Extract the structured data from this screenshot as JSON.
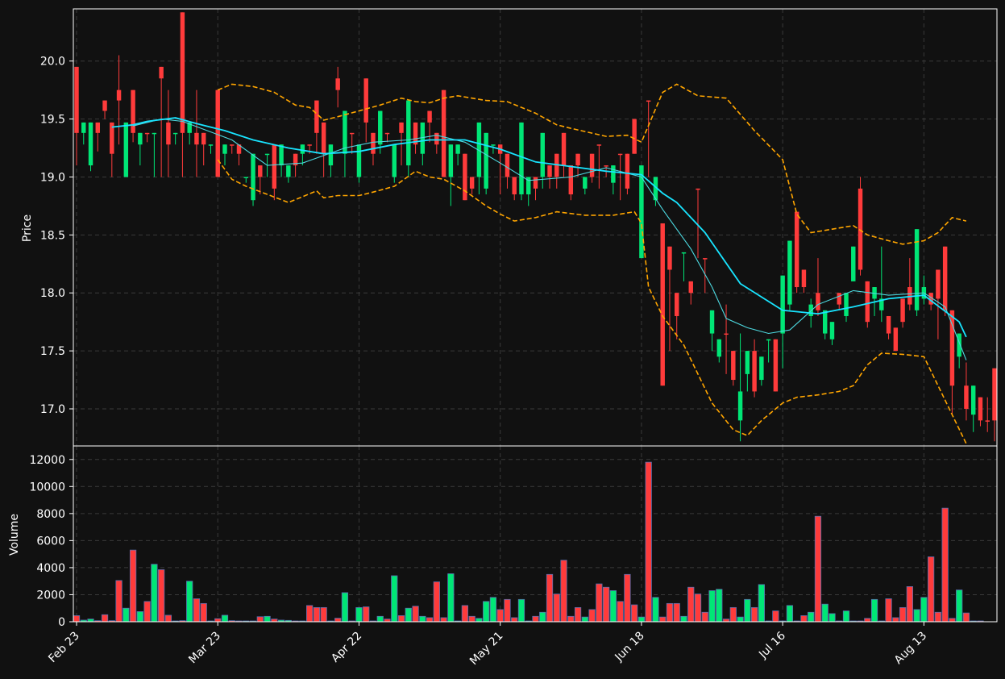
{
  "chart_data": {
    "type": "candlestick",
    "price_panel": {
      "ylabel": "Price",
      "ylim": [
        16.68,
        20.45
      ],
      "yticks": [
        17.0,
        17.5,
        18.0,
        18.5,
        19.0,
        19.5,
        20.0
      ],
      "ytick_labels": [
        "17.0",
        "17.5",
        "18.0",
        "18.5",
        "19.0",
        "19.5",
        "20.0"
      ],
      "grid": true
    },
    "volume_panel": {
      "ylabel": "Volume",
      "ylim": [
        0,
        13000
      ],
      "yticks": [
        0,
        2000,
        4000,
        6000,
        8000,
        10000,
        12000
      ],
      "ytick_labels": [
        "0",
        "2000",
        "4000",
        "6000",
        "8000",
        "10000",
        "12000"
      ],
      "grid": true
    },
    "x_axis": {
      "tick_labels": [
        "Feb 23",
        "Mar 23",
        "Apr 22",
        "May 21",
        "Jun 18",
        "Jul 16",
        "Aug 13"
      ],
      "tick_index": [
        0,
        20,
        40,
        60,
        80,
        100,
        120
      ]
    },
    "colors": {
      "up": "#00e676",
      "down": "#ff3b3b",
      "ma_short": "#4dd9e0",
      "ma_long": "#18e4ff",
      "bands": "#ffa500",
      "grid": "#3a3a3a",
      "frame": "#ffffff"
    },
    "candles": [
      [
        19.38,
        19.95,
        19.1,
        19.95
      ],
      [
        19.38,
        19.47,
        19.28,
        19.47
      ],
      [
        19.1,
        19.47,
        19.05,
        19.47
      ],
      [
        19.38,
        19.47,
        19.22,
        19.47
      ],
      [
        19.57,
        19.66,
        19.5,
        19.66
      ],
      [
        19.2,
        19.47,
        19.0,
        19.47
      ],
      [
        19.66,
        19.75,
        19.28,
        20.05
      ],
      [
        19.0,
        19.47,
        19.0,
        19.47
      ],
      [
        19.38,
        19.75,
        19.3,
        19.75
      ],
      [
        19.28,
        19.38,
        19.1,
        19.38
      ],
      [
        19.38,
        19.38,
        19.3,
        19.38
      ],
      [
        19.38,
        19.38,
        19.0,
        19.38
      ],
      [
        19.85,
        19.95,
        19.0,
        19.95
      ],
      [
        19.28,
        19.47,
        19.0,
        19.75
      ],
      [
        19.38,
        19.38,
        19.28,
        19.38
      ],
      [
        19.38,
        20.42,
        19.0,
        20.42
      ],
      [
        19.38,
        19.47,
        19.28,
        19.47
      ],
      [
        19.28,
        19.38,
        19.0,
        19.75
      ],
      [
        19.28,
        19.38,
        19.1,
        19.38
      ],
      [
        19.28,
        19.28,
        19.2,
        19.28
      ],
      [
        19.0,
        19.75,
        19.0,
        19.75
      ],
      [
        19.2,
        19.28,
        19.1,
        19.28
      ],
      [
        19.28,
        19.28,
        19.2,
        19.28
      ],
      [
        19.2,
        19.28,
        19.1,
        19.28
      ],
      [
        19.0,
        19.0,
        18.95,
        19.0
      ],
      [
        18.8,
        19.2,
        18.75,
        19.2
      ],
      [
        19.0,
        19.1,
        18.85,
        19.1
      ],
      [
        19.2,
        19.2,
        19.0,
        19.2
      ],
      [
        18.9,
        19.28,
        18.8,
        19.28
      ],
      [
        19.1,
        19.28,
        19.0,
        19.28
      ],
      [
        19.0,
        19.1,
        18.95,
        19.1
      ],
      [
        19.1,
        19.2,
        19.0,
        19.2
      ],
      [
        19.2,
        19.28,
        19.1,
        19.28
      ],
      [
        19.28,
        19.28,
        19.2,
        19.28
      ],
      [
        19.38,
        19.66,
        19.2,
        19.66
      ],
      [
        19.2,
        19.47,
        19.0,
        19.47
      ],
      [
        19.1,
        19.28,
        19.0,
        19.28
      ],
      [
        19.75,
        19.85,
        19.6,
        19.95
      ],
      [
        19.2,
        19.57,
        19.0,
        19.57
      ],
      [
        19.38,
        19.38,
        19.2,
        19.38
      ],
      [
        19.0,
        19.28,
        18.95,
        19.28
      ],
      [
        19.47,
        19.85,
        19.3,
        19.85
      ],
      [
        19.2,
        19.38,
        19.1,
        19.38
      ],
      [
        19.28,
        19.57,
        19.2,
        19.57
      ],
      [
        19.38,
        19.38,
        19.3,
        19.38
      ],
      [
        19.0,
        19.28,
        18.95,
        19.28
      ],
      [
        19.38,
        19.47,
        19.1,
        19.47
      ],
      [
        19.1,
        19.66,
        19.0,
        19.66
      ],
      [
        19.28,
        19.47,
        19.2,
        19.47
      ],
      [
        19.2,
        19.47,
        19.1,
        19.47
      ],
      [
        19.47,
        19.57,
        19.3,
        19.57
      ],
      [
        19.28,
        19.38,
        19.2,
        19.38
      ],
      [
        19.0,
        19.75,
        19.0,
        19.75
      ],
      [
        19.0,
        19.28,
        18.75,
        19.28
      ],
      [
        19.2,
        19.28,
        19.1,
        19.28
      ],
      [
        18.8,
        19.2,
        18.8,
        19.2
      ],
      [
        18.9,
        19.0,
        18.85,
        19.0
      ],
      [
        19.0,
        19.47,
        18.85,
        19.47
      ],
      [
        18.9,
        19.38,
        18.85,
        19.38
      ],
      [
        19.28,
        19.28,
        19.2,
        19.28
      ],
      [
        19.2,
        19.28,
        18.85,
        19.28
      ],
      [
        19.0,
        19.2,
        18.9,
        19.2
      ],
      [
        18.85,
        19.0,
        18.8,
        19.0
      ],
      [
        18.85,
        19.47,
        18.8,
        19.47
      ],
      [
        18.85,
        19.0,
        18.75,
        19.0
      ],
      [
        18.9,
        19.0,
        18.8,
        19.0
      ],
      [
        19.0,
        19.38,
        18.9,
        19.38
      ],
      [
        19.0,
        19.1,
        18.9,
        19.1
      ],
      [
        19.0,
        19.2,
        18.9,
        19.2
      ],
      [
        19.1,
        19.38,
        19.0,
        19.38
      ],
      [
        18.85,
        19.1,
        18.8,
        19.1
      ],
      [
        19.1,
        19.2,
        19.0,
        19.2
      ],
      [
        18.9,
        19.0,
        18.85,
        19.0
      ],
      [
        19.0,
        19.2,
        18.95,
        19.2
      ],
      [
        19.28,
        19.28,
        18.9,
        19.28
      ],
      [
        19.1,
        19.1,
        19.0,
        19.1
      ],
      [
        18.95,
        19.1,
        18.85,
        19.1
      ],
      [
        19.2,
        19.2,
        18.8,
        19.2
      ],
      [
        18.9,
        19.2,
        18.85,
        19.2
      ],
      [
        19.2,
        19.5,
        19.2,
        19.5
      ],
      [
        18.3,
        19.1,
        18.3,
        19.1
      ],
      [
        19.66,
        19.66,
        19.0,
        19.66
      ],
      [
        18.8,
        19.0,
        18.75,
        19.0
      ],
      [
        17.2,
        18.6,
        17.2,
        18.6
      ],
      [
        18.2,
        18.4,
        17.5,
        18.4
      ],
      [
        17.8,
        18.0,
        17.6,
        18.0
      ],
      [
        18.35,
        18.35,
        18.1,
        18.35
      ],
      [
        18.0,
        18.1,
        17.9,
        18.1
      ],
      [
        18.9,
        18.9,
        18.3,
        18.9
      ],
      [
        18.3,
        18.3,
        18.0,
        18.3
      ],
      [
        17.65,
        17.85,
        17.5,
        17.85
      ],
      [
        17.45,
        17.6,
        17.4,
        17.6
      ],
      [
        17.65,
        17.65,
        17.3,
        17.9
      ],
      [
        17.25,
        17.5,
        17.2,
        17.5
      ],
      [
        16.9,
        17.15,
        16.72,
        17.65
      ],
      [
        17.3,
        17.5,
        17.15,
        17.5
      ],
      [
        17.15,
        17.5,
        17.1,
        17.6
      ],
      [
        17.25,
        17.45,
        17.2,
        17.45
      ],
      [
        17.6,
        17.6,
        17.4,
        17.6
      ],
      [
        17.15,
        17.6,
        17.15,
        17.6
      ],
      [
        17.65,
        18.15,
        17.35,
        18.15
      ],
      [
        17.9,
        18.45,
        17.85,
        18.45
      ],
      [
        18.05,
        18.7,
        18.0,
        18.7
      ],
      [
        18.05,
        18.2,
        18.0,
        18.2
      ],
      [
        17.8,
        17.9,
        17.7,
        17.95
      ],
      [
        17.85,
        18.0,
        17.8,
        18.3
      ],
      [
        17.65,
        17.85,
        17.6,
        17.85
      ],
      [
        17.6,
        17.75,
        17.55,
        17.75
      ],
      [
        17.9,
        18.0,
        17.85,
        18.0
      ],
      [
        17.8,
        18.0,
        17.75,
        18.0
      ],
      [
        18.1,
        18.4,
        18.1,
        18.4
      ],
      [
        18.2,
        18.9,
        18.15,
        19.0
      ],
      [
        17.75,
        18.1,
        17.7,
        18.1
      ],
      [
        17.95,
        18.05,
        17.8,
        18.05
      ],
      [
        17.85,
        17.95,
        17.75,
        18.4
      ],
      [
        17.65,
        17.8,
        17.6,
        17.8
      ],
      [
        17.5,
        17.7,
        17.5,
        17.7
      ],
      [
        17.75,
        17.95,
        17.7,
        17.95
      ],
      [
        17.9,
        18.05,
        17.85,
        18.3
      ],
      [
        17.85,
        18.55,
        17.8,
        18.55
      ],
      [
        17.95,
        18.05,
        17.9,
        18.15
      ],
      [
        17.9,
        18.0,
        17.85,
        18.0
      ],
      [
        17.95,
        18.2,
        17.6,
        18.2
      ],
      [
        17.85,
        18.4,
        17.8,
        18.4
      ],
      [
        17.2,
        17.85,
        16.95,
        17.85
      ],
      [
        17.45,
        17.65,
        17.35,
        17.65
      ],
      [
        17.0,
        17.2,
        16.9,
        17.4
      ],
      [
        16.95,
        17.2,
        16.8,
        17.2
      ],
      [
        16.9,
        17.1,
        16.85,
        17.1
      ],
      [
        16.9,
        16.9,
        16.8,
        17.1
      ],
      [
        16.9,
        17.35,
        16.72,
        17.35
      ]
    ],
    "up_flags": [
      0,
      1,
      1,
      0,
      0,
      0,
      0,
      1,
      0,
      1,
      0,
      1,
      0,
      0,
      1,
      0,
      1,
      0,
      0,
      1,
      0,
      1,
      0,
      0,
      1,
      1,
      0,
      1,
      0,
      1,
      1,
      0,
      1,
      0,
      0,
      0,
      1,
      0,
      1,
      0,
      1,
      0,
      0,
      1,
      0,
      1,
      0,
      1,
      0,
      1,
      0,
      0,
      0,
      1,
      1,
      0,
      0,
      1,
      1,
      1,
      0,
      0,
      0,
      1,
      1,
      0,
      1,
      0,
      0,
      0,
      0,
      0,
      1,
      0,
      0,
      0,
      1,
      0,
      0,
      0,
      1,
      0,
      1,
      0,
      0,
      0,
      1,
      0,
      0,
      0,
      1,
      1,
      0,
      0,
      1,
      1,
      0,
      1,
      1,
      0,
      1,
      1,
      0,
      0,
      1,
      0,
      1,
      1,
      0,
      1,
      1,
      0,
      0,
      1,
      1,
      0,
      0,
      0,
      0,
      1,
      1,
      0,
      0,
      0,
      0,
      1,
      0,
      1,
      0,
      0,
      0,
      0,
      0
    ],
    "volume": [
      450,
      120,
      200,
      80,
      520,
      80,
      3050,
      1000,
      5300,
      750,
      1500,
      4250,
      3850,
      480,
      60,
      80,
      3000,
      1700,
      1350,
      60,
      230,
      480,
      80,
      60,
      60,
      60,
      370,
      400,
      200,
      120,
      100,
      60,
      60,
      1200,
      1050,
      1050,
      60,
      260,
      2150,
      60,
      1050,
      1100,
      60,
      400,
      200,
      3400,
      450,
      1000,
      1150,
      400,
      300,
      2950,
      300,
      3550,
      60,
      1200,
      400,
      250,
      1500,
      1800,
      900,
      1650,
      300,
      1650,
      60,
      400,
      700,
      3500,
      2050,
      4550,
      400,
      1050,
      350,
      900,
      2800,
      2550,
      2300,
      1500,
      3500,
      1250,
      350,
      11800,
      1800,
      350,
      1350,
      1350,
      400,
      2550,
      2050,
      700,
      2300,
      2400,
      200,
      1050,
      350,
      1650,
      1050,
      2750,
      60,
      800,
      60,
      1200,
      60,
      450,
      700,
      7800,
      1300,
      600,
      60,
      800,
      60,
      60,
      250,
      1650,
      60,
      1700,
      300,
      1050,
      2600,
      900,
      1800,
      4800,
      700,
      8400,
      250,
      2350,
      650,
      60,
      60
    ],
    "ma_long": [
      [
        5,
        19.43
      ],
      [
        8,
        19.45
      ],
      [
        10,
        19.48
      ],
      [
        14,
        19.51
      ],
      [
        17,
        19.46
      ],
      [
        21,
        19.4
      ],
      [
        25,
        19.32
      ],
      [
        30,
        19.25
      ],
      [
        35,
        19.2
      ],
      [
        40,
        19.22
      ],
      [
        45,
        19.28
      ],
      [
        50,
        19.32
      ],
      [
        55,
        19.32
      ],
      [
        60,
        19.24
      ],
      [
        65,
        19.13
      ],
      [
        70,
        19.09
      ],
      [
        75,
        19.05
      ],
      [
        80,
        19.02
      ],
      [
        83,
        18.86
      ],
      [
        85,
        18.78
      ],
      [
        89,
        18.52
      ],
      [
        94,
        18.08
      ],
      [
        100,
        17.85
      ],
      [
        105,
        17.82
      ],
      [
        110,
        17.88
      ],
      [
        115,
        17.95
      ],
      [
        120,
        17.98
      ],
      [
        125,
        17.75
      ],
      [
        126,
        17.62
      ]
    ],
    "ma_short": [
      [
        8,
        19.44
      ],
      [
        12,
        19.5
      ],
      [
        15,
        19.48
      ],
      [
        22,
        19.32
      ],
      [
        27,
        19.1
      ],
      [
        32,
        19.12
      ],
      [
        38,
        19.25
      ],
      [
        42,
        19.3
      ],
      [
        47,
        19.32
      ],
      [
        51,
        19.36
      ],
      [
        55,
        19.3
      ],
      [
        60,
        19.12
      ],
      [
        64,
        18.97
      ],
      [
        70,
        19.0
      ],
      [
        75,
        19.08
      ],
      [
        80,
        19.0
      ],
      [
        83,
        18.72
      ],
      [
        85,
        18.55
      ],
      [
        87,
        18.38
      ],
      [
        90,
        18.05
      ],
      [
        92,
        17.78
      ],
      [
        95,
        17.7
      ],
      [
        98,
        17.65
      ],
      [
        101,
        17.68
      ],
      [
        105,
        17.9
      ],
      [
        110,
        18.02
      ],
      [
        115,
        17.98
      ],
      [
        120,
        18.0
      ],
      [
        123,
        17.88
      ],
      [
        126,
        17.42
      ]
    ],
    "band_upper": [
      [
        20,
        19.75
      ],
      [
        22,
        19.8
      ],
      [
        25,
        19.78
      ],
      [
        28,
        19.73
      ],
      [
        31,
        19.62
      ],
      [
        33,
        19.6
      ],
      [
        35,
        19.49
      ],
      [
        37,
        19.52
      ],
      [
        40,
        19.57
      ],
      [
        43,
        19.62
      ],
      [
        46,
        19.68
      ],
      [
        48,
        19.65
      ],
      [
        50,
        19.64
      ],
      [
        52,
        19.68
      ],
      [
        54,
        19.7
      ],
      [
        58,
        19.66
      ],
      [
        61,
        19.65
      ],
      [
        65,
        19.55
      ],
      [
        68,
        19.45
      ],
      [
        70,
        19.42
      ],
      [
        75,
        19.35
      ],
      [
        78,
        19.36
      ],
      [
        80,
        19.3
      ],
      [
        83,
        19.73
      ],
      [
        85,
        19.8
      ],
      [
        88,
        19.7
      ],
      [
        92,
        19.68
      ],
      [
        96,
        19.4
      ],
      [
        100,
        19.15
      ],
      [
        102,
        18.68
      ],
      [
        104,
        18.52
      ],
      [
        107,
        18.55
      ],
      [
        110,
        18.58
      ],
      [
        112,
        18.5
      ],
      [
        115,
        18.45
      ],
      [
        117,
        18.42
      ],
      [
        120,
        18.45
      ],
      [
        122,
        18.52
      ],
      [
        124,
        18.65
      ],
      [
        126,
        18.62
      ]
    ],
    "band_lower": [
      [
        20,
        19.15
      ],
      [
        22,
        18.98
      ],
      [
        24,
        18.92
      ],
      [
        27,
        18.85
      ],
      [
        30,
        18.78
      ],
      [
        32,
        18.83
      ],
      [
        34,
        18.88
      ],
      [
        35,
        18.82
      ],
      [
        37,
        18.84
      ],
      [
        40,
        18.84
      ],
      [
        42,
        18.87
      ],
      [
        45,
        18.92
      ],
      [
        48,
        19.05
      ],
      [
        50,
        19.0
      ],
      [
        52,
        18.98
      ],
      [
        55,
        18.88
      ],
      [
        58,
        18.75
      ],
      [
        60,
        18.68
      ],
      [
        62,
        18.62
      ],
      [
        65,
        18.65
      ],
      [
        68,
        18.7
      ],
      [
        72,
        18.67
      ],
      [
        76,
        18.67
      ],
      [
        79,
        18.7
      ],
      [
        80,
        18.6
      ],
      [
        81,
        18.05
      ],
      [
        83,
        17.8
      ],
      [
        86,
        17.55
      ],
      [
        90,
        17.05
      ],
      [
        93,
        16.82
      ],
      [
        95,
        16.77
      ],
      [
        97,
        16.9
      ],
      [
        100,
        17.05
      ],
      [
        102,
        17.1
      ],
      [
        105,
        17.12
      ],
      [
        108,
        17.15
      ],
      [
        110,
        17.2
      ],
      [
        112,
        17.38
      ],
      [
        114,
        17.48
      ],
      [
        117,
        17.47
      ],
      [
        120,
        17.45
      ],
      [
        122,
        17.2
      ],
      [
        124,
        16.95
      ],
      [
        126,
        16.7
      ]
    ]
  }
}
